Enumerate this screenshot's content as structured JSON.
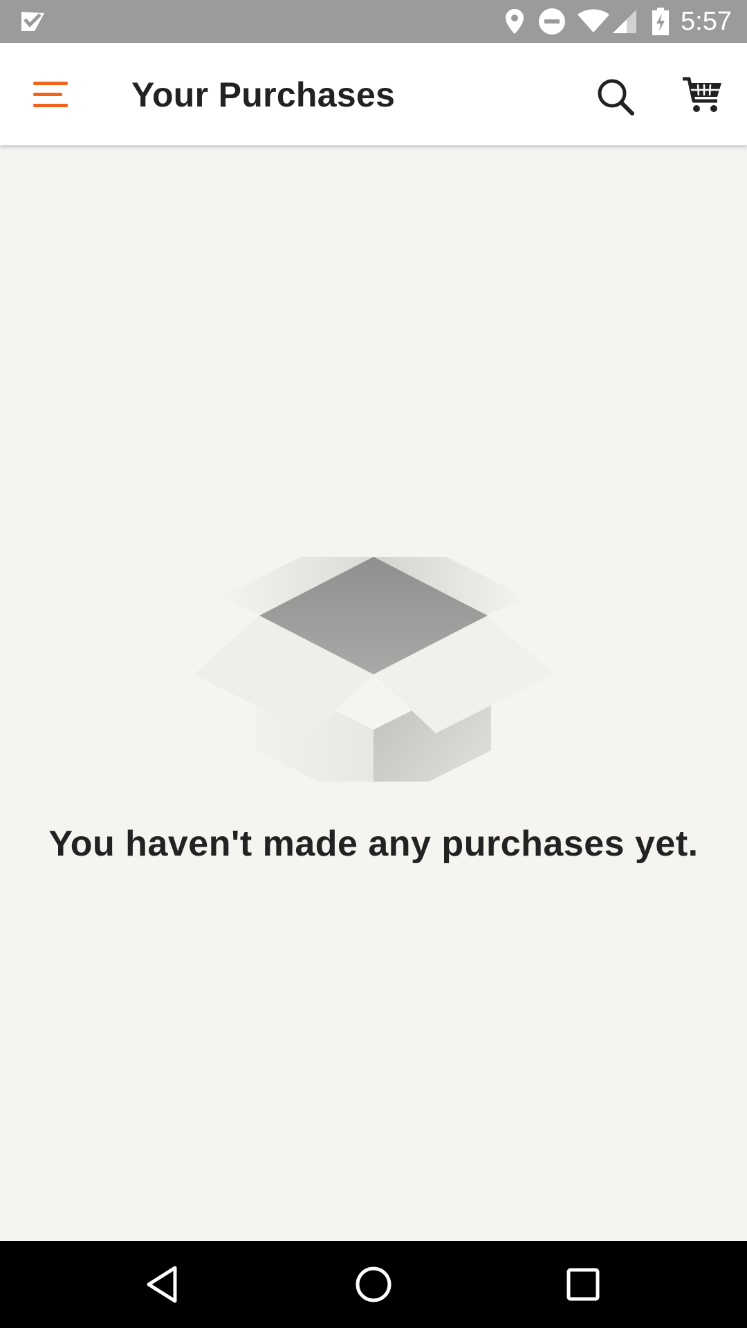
{
  "status_bar": {
    "time": "5:57",
    "icons": [
      "notification-check-icon",
      "location-pin-icon",
      "do-not-disturb-icon",
      "wifi-icon",
      "cell-signal-icon",
      "battery-charging-icon"
    ]
  },
  "app_bar": {
    "title": "Your Purchases",
    "menu_icon": "hamburger-menu-icon",
    "search_icon": "search-icon",
    "cart_icon": "shopping-cart-icon",
    "accent_color": "#f1641e"
  },
  "content": {
    "illustration": "open-box-icon",
    "empty_message": "You haven't made any purchases yet."
  },
  "nav_bar": {
    "buttons": [
      "back-icon",
      "home-icon",
      "recents-icon"
    ]
  }
}
